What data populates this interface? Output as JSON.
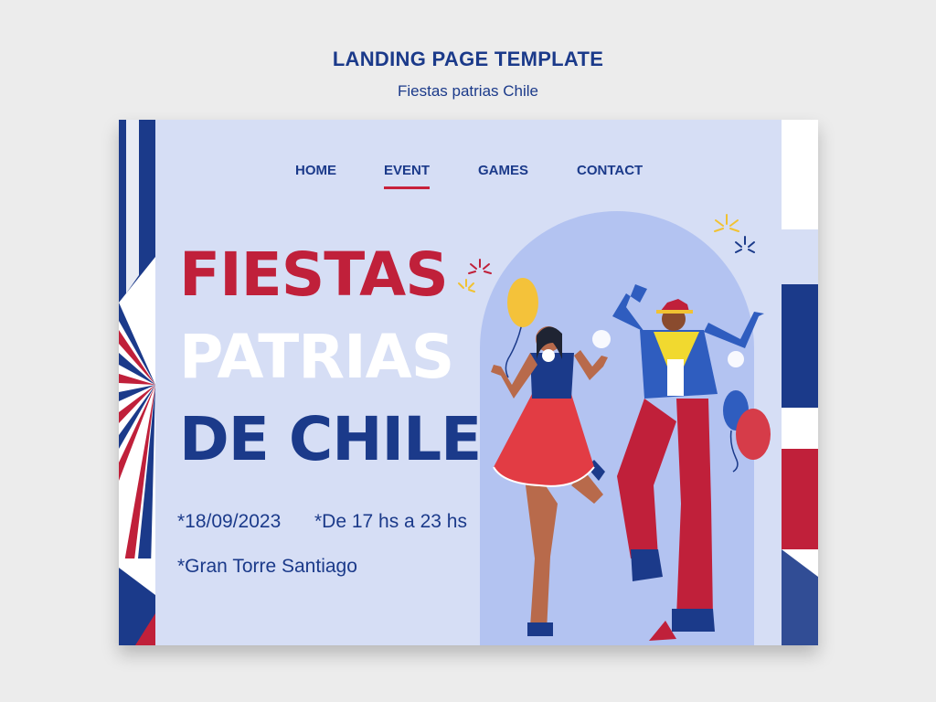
{
  "header": {
    "title": "LANDING PAGE TEMPLATE",
    "subtitle": "Fiestas patrias Chile"
  },
  "nav": {
    "items": [
      "HOME",
      "EVENT",
      "GAMES",
      "CONTACT"
    ],
    "active": "EVENT"
  },
  "hero": {
    "line1": "FIESTAS",
    "line2": "PATRIAS",
    "line3": "DE CHILE"
  },
  "details": {
    "date": "*18/09/2023",
    "time": "*De 17 hs a 23 hs",
    "location": "*Gran Torre Santiago"
  },
  "illustration": {
    "icons": [
      "balloon-icon",
      "firework-icon",
      "dancing-woman-illustration",
      "dancing-man-illustration",
      "flag-stripes"
    ]
  },
  "colors": {
    "red": "#c0203a",
    "navy": "#1b3a8a",
    "card": "#d6def5",
    "arch": "#b3c3f1"
  }
}
